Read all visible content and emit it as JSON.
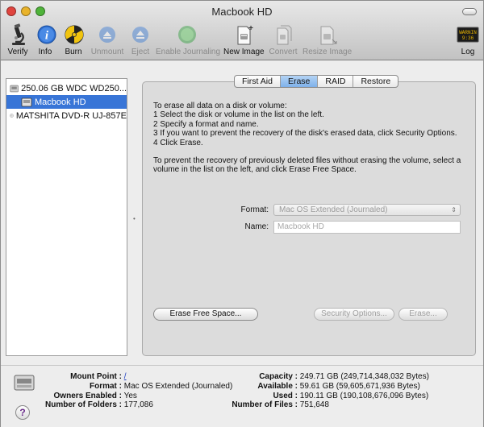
{
  "window": {
    "title": "Macbook HD",
    "colors": {
      "close": "#e0443e",
      "minimize": "#e9b32b",
      "zoom": "#4fb33a",
      "selection": "#3875d7",
      "active_tab": "#8dbbee"
    }
  },
  "toolbar": {
    "buttons": [
      {
        "label": "Verify",
        "icon": "microscope-icon",
        "enabled": true
      },
      {
        "label": "Info",
        "icon": "info-icon",
        "enabled": true
      },
      {
        "label": "Burn",
        "icon": "burn-icon",
        "enabled": true
      },
      {
        "label": "Unmount",
        "icon": "unmount-icon",
        "enabled": false
      },
      {
        "label": "Eject",
        "icon": "eject-icon",
        "enabled": false
      },
      {
        "label": "Enable Journaling",
        "icon": "journaling-icon",
        "enabled": false
      },
      {
        "label": "New Image",
        "icon": "new-image-icon",
        "enabled": true
      },
      {
        "label": "Convert",
        "icon": "convert-icon",
        "enabled": false
      },
      {
        "label": "Resize Image",
        "icon": "resize-image-icon",
        "enabled": false
      },
      {
        "label": "Log",
        "icon": "log-icon",
        "enabled": true
      }
    ],
    "log_icon_text": "WARNIN\n9:36"
  },
  "sidebar": {
    "items": [
      {
        "label": "250.06 GB WDC WD250...",
        "icon": "hard-disk-icon",
        "selected": false,
        "indent": false
      },
      {
        "label": "Macbook HD",
        "icon": "volume-icon",
        "selected": true,
        "indent": true
      },
      {
        "label": "MATSHITA DVD-R UJ-857E",
        "icon": "optical-drive-icon",
        "selected": false,
        "indent": false
      }
    ]
  },
  "tabs": [
    {
      "label": "First Aid",
      "active": false
    },
    {
      "label": "Erase",
      "active": true
    },
    {
      "label": "RAID",
      "active": false
    },
    {
      "label": "Restore",
      "active": false
    }
  ],
  "erase": {
    "instructions": [
      "To erase all data on a disk or volume:",
      "1 Select the disk or volume in the list on the left.",
      "2 Specify a format and name.",
      "3 If you want to prevent the recovery of the disk's erased data, click Security Options.",
      "4 Click Erase."
    ],
    "free_space_note": "To prevent the recovery of previously deleted files without erasing the volume, select a volume in the list on the left, and click Erase Free Space.",
    "format_label": "Format:",
    "format_value": "Mac OS Extended (Journaled)",
    "name_label": "Name:",
    "name_value": "Macbook HD",
    "erase_free_space_button": "Erase Free Space...",
    "security_options_button": "Security Options...",
    "erase_button": "Erase..."
  },
  "footer": {
    "left": [
      {
        "key": "Mount Point :",
        "value": "/"
      },
      {
        "key": "Format :",
        "value": "Mac OS Extended (Journaled)"
      },
      {
        "key": "Owners Enabled :",
        "value": "Yes"
      },
      {
        "key": "Number of Folders :",
        "value": "177,086"
      }
    ],
    "right": [
      {
        "key": "Capacity :",
        "value": "249.71 GB (249,714,348,032 Bytes)"
      },
      {
        "key": "Available :",
        "value": "59.61 GB (59,605,671,936 Bytes)"
      },
      {
        "key": "Used :",
        "value": "190.11 GB (190,108,676,096 Bytes)"
      },
      {
        "key": "Number of Files :",
        "value": "751,648"
      }
    ],
    "help_label": "?"
  }
}
